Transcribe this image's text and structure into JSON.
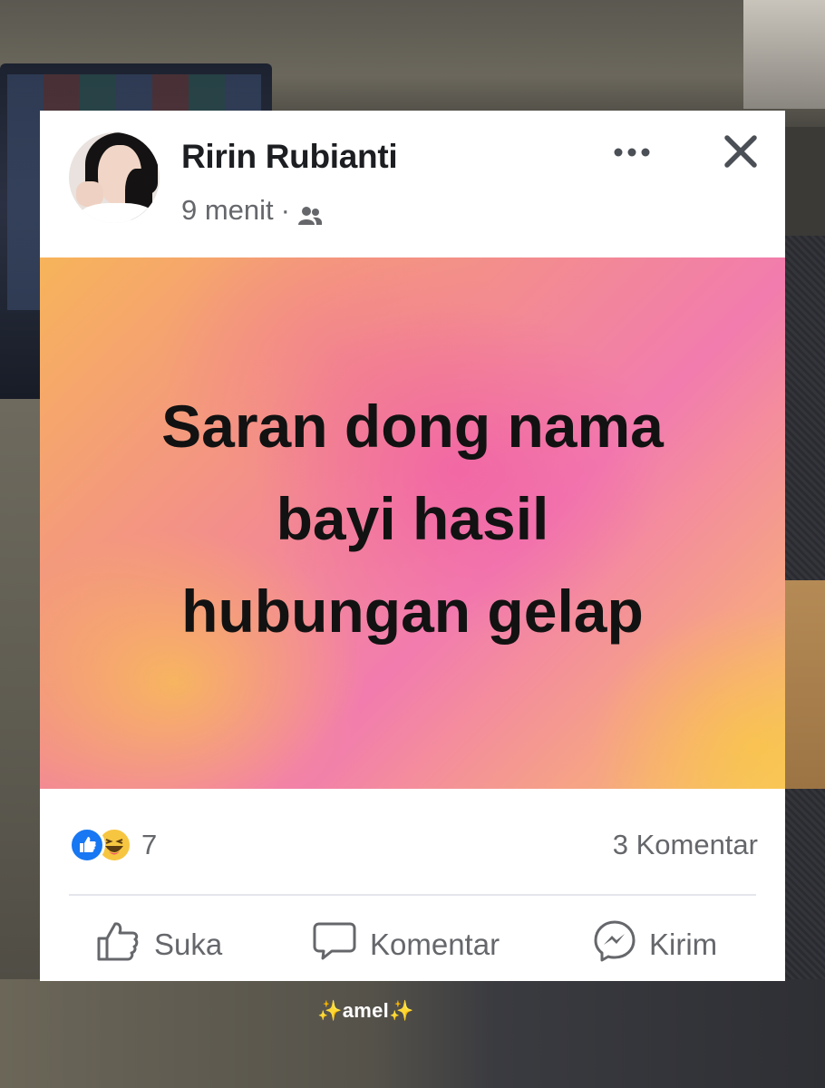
{
  "post": {
    "author": "Ririn Rubianti",
    "time": "9 menit",
    "separator": "·",
    "text": "Saran dong nama\nbayi hasil\nhubungan gelap",
    "background_colors": [
      "#f7b45a",
      "#f27cae",
      "#f8c766"
    ]
  },
  "header": {
    "more_icon": "more-options-icon",
    "close_icon": "close-icon",
    "audience_icon": "friends-icon"
  },
  "footer": {
    "reaction_icons": [
      "like-reaction",
      "haha-reaction"
    ],
    "reaction_count": "7",
    "comments_count": "3 Komentar"
  },
  "actions": {
    "like_label": "Suka",
    "comment_label": "Komentar",
    "share_label": "Kirim"
  },
  "watermark": {
    "left": "✨",
    "text": "amel",
    "right": "✨"
  },
  "colors": {
    "link_blue": "#1877f2",
    "text_primary": "#1c1e21",
    "text_secondary": "#65676b"
  }
}
